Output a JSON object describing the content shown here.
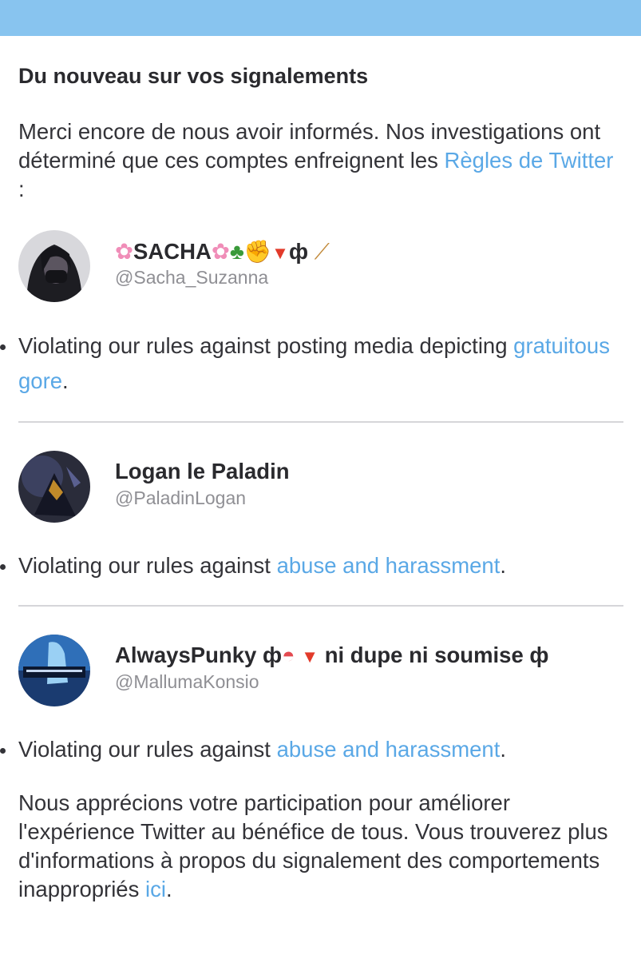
{
  "header": {
    "title": "Du nouveau sur vos signalements"
  },
  "intro": {
    "text": "Merci encore de nous avoir informés. Nos investigations ont déterminé que ces comptes enfreignent les ",
    "link": "Règles de Twitter",
    "suffix": " :"
  },
  "accounts": [
    {
      "name": "SACHA",
      "handle": "@Sacha_Suzanna",
      "violation_prefix": "Violating our rules against posting media depicting ",
      "violation_link": "gratuitous gore",
      "violation_suffix": ".",
      "icons": [
        "cherry-blossom-icon",
        "clover-icon",
        "raised-fist-icon",
        "red-triangle-icon",
        "phi-symbol",
        "broom-icon"
      ]
    },
    {
      "name": "Logan le Paladin",
      "handle": "@PaladinLogan",
      "violation_prefix": "Violating our rules against ",
      "violation_link": "abuse and harassment",
      "violation_suffix": "."
    },
    {
      "name_prefix": "AlwaysPunky ",
      "name_suffix": " ni dupe ni soumise ",
      "handle": "@MallumaKonsio",
      "violation_prefix": "Violating our rules against ",
      "violation_link": "abuse and harassment",
      "violation_suffix": ".",
      "icons": [
        "phi-symbol",
        "watermelon-icon",
        "red-triangle-icon"
      ]
    }
  ],
  "glyphs": {
    "phi": "ф"
  },
  "outro": {
    "text": "Nous apprécions votre participation pour améliorer l'expérience Twitter au bénéfice de tous. Vous trouverez plus d'informations à propos du signalement des comportements inappropriés ",
    "link": "ici",
    "suffix": "."
  },
  "colors": {
    "topbar": "#88c4ef",
    "link": "#5aa8e6",
    "handle": "#8f8f94",
    "divider": "#d6d6d9"
  }
}
